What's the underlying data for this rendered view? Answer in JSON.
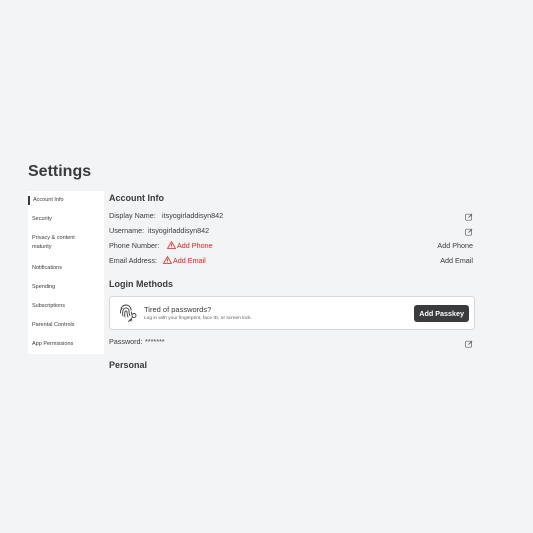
{
  "page": {
    "title": "Settings"
  },
  "sidebar": {
    "items": [
      {
        "label": "Account Info",
        "active": true
      },
      {
        "label": "Security"
      },
      {
        "label": "Privacy & content maturity"
      },
      {
        "label": "Notifications"
      },
      {
        "label": "Spending"
      },
      {
        "label": "Subscriptions"
      },
      {
        "label": "Parental Controls"
      },
      {
        "label": "App Permissions"
      }
    ]
  },
  "account_info": {
    "title": "Account Info",
    "display_name": {
      "label": "Display Name:",
      "value": "itsyogirladdisyn842"
    },
    "username": {
      "label": "Username:",
      "value": "itsyogirladdisyn842"
    },
    "phone": {
      "label": "Phone Number:",
      "warning": "Add Phone",
      "action": "Add Phone"
    },
    "email": {
      "label": "Email Address:",
      "warning": "Add Email",
      "action": "Add Email"
    }
  },
  "login_methods": {
    "title": "Login Methods",
    "passkey": {
      "title": "Tired of passwords?",
      "subtitle": "Log in with your fingerprint, face ID, or screen lock.",
      "button": "Add Passkey"
    },
    "password": {
      "label": "Password:",
      "value": "*******"
    }
  },
  "personal": {
    "title": "Personal"
  },
  "colors": {
    "background": "#f2f4f5",
    "text": "#393b3d",
    "warning": "#e2231a",
    "button_bg": "#393b3d"
  },
  "icons": {
    "edit": "edit-icon",
    "warning": "warning-triangle-icon",
    "fingerprint": "fingerprint-key-icon"
  }
}
